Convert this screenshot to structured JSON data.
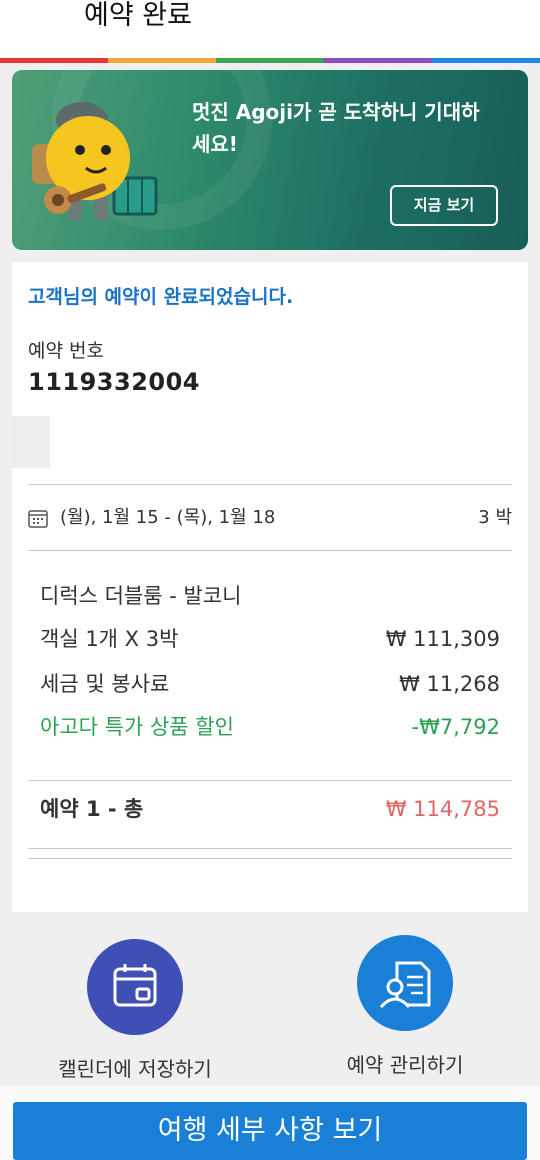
{
  "header": {
    "title": "예약 완료"
  },
  "rainbow_colors": [
    "#e53935",
    "#f0a73a",
    "#3aa757",
    "#8e4bbf",
    "#1e88e5"
  ],
  "banner": {
    "message": "멋진 Agoji가 곧 도착하니 기대하세요!",
    "button_label": "지금 보기"
  },
  "confirmation": {
    "heading": "고객님의 예약이 완료되었습니다.",
    "booking_label": "예약 번호",
    "booking_number": "1119332004"
  },
  "stay": {
    "date_range": "(월), 1월 15 - (목), 1월 18",
    "nights": "3 박"
  },
  "pricing": {
    "room_name": "디럭스 더블룸 - 발코니",
    "lines": [
      {
        "label": "객실 1개 X 3박",
        "value": "₩ 111,309"
      },
      {
        "label": "세금 및 봉사료",
        "value": "₩ 11,268"
      },
      {
        "label": "아고다 특가 상품 할인",
        "value": "-₩7,792"
      }
    ],
    "total_label": "예약 1 - 총",
    "total_value": "₩ 114,785"
  },
  "actions": [
    {
      "label": "캘린더에 저장하기",
      "icon": "calendar-icon",
      "color": "#3f4fb5"
    },
    {
      "label": "예약 관리하기",
      "icon": "manage-booking-icon",
      "color": "#1a7fd6"
    }
  ],
  "primary_button": {
    "label": "여행 세부 사항 보기"
  }
}
